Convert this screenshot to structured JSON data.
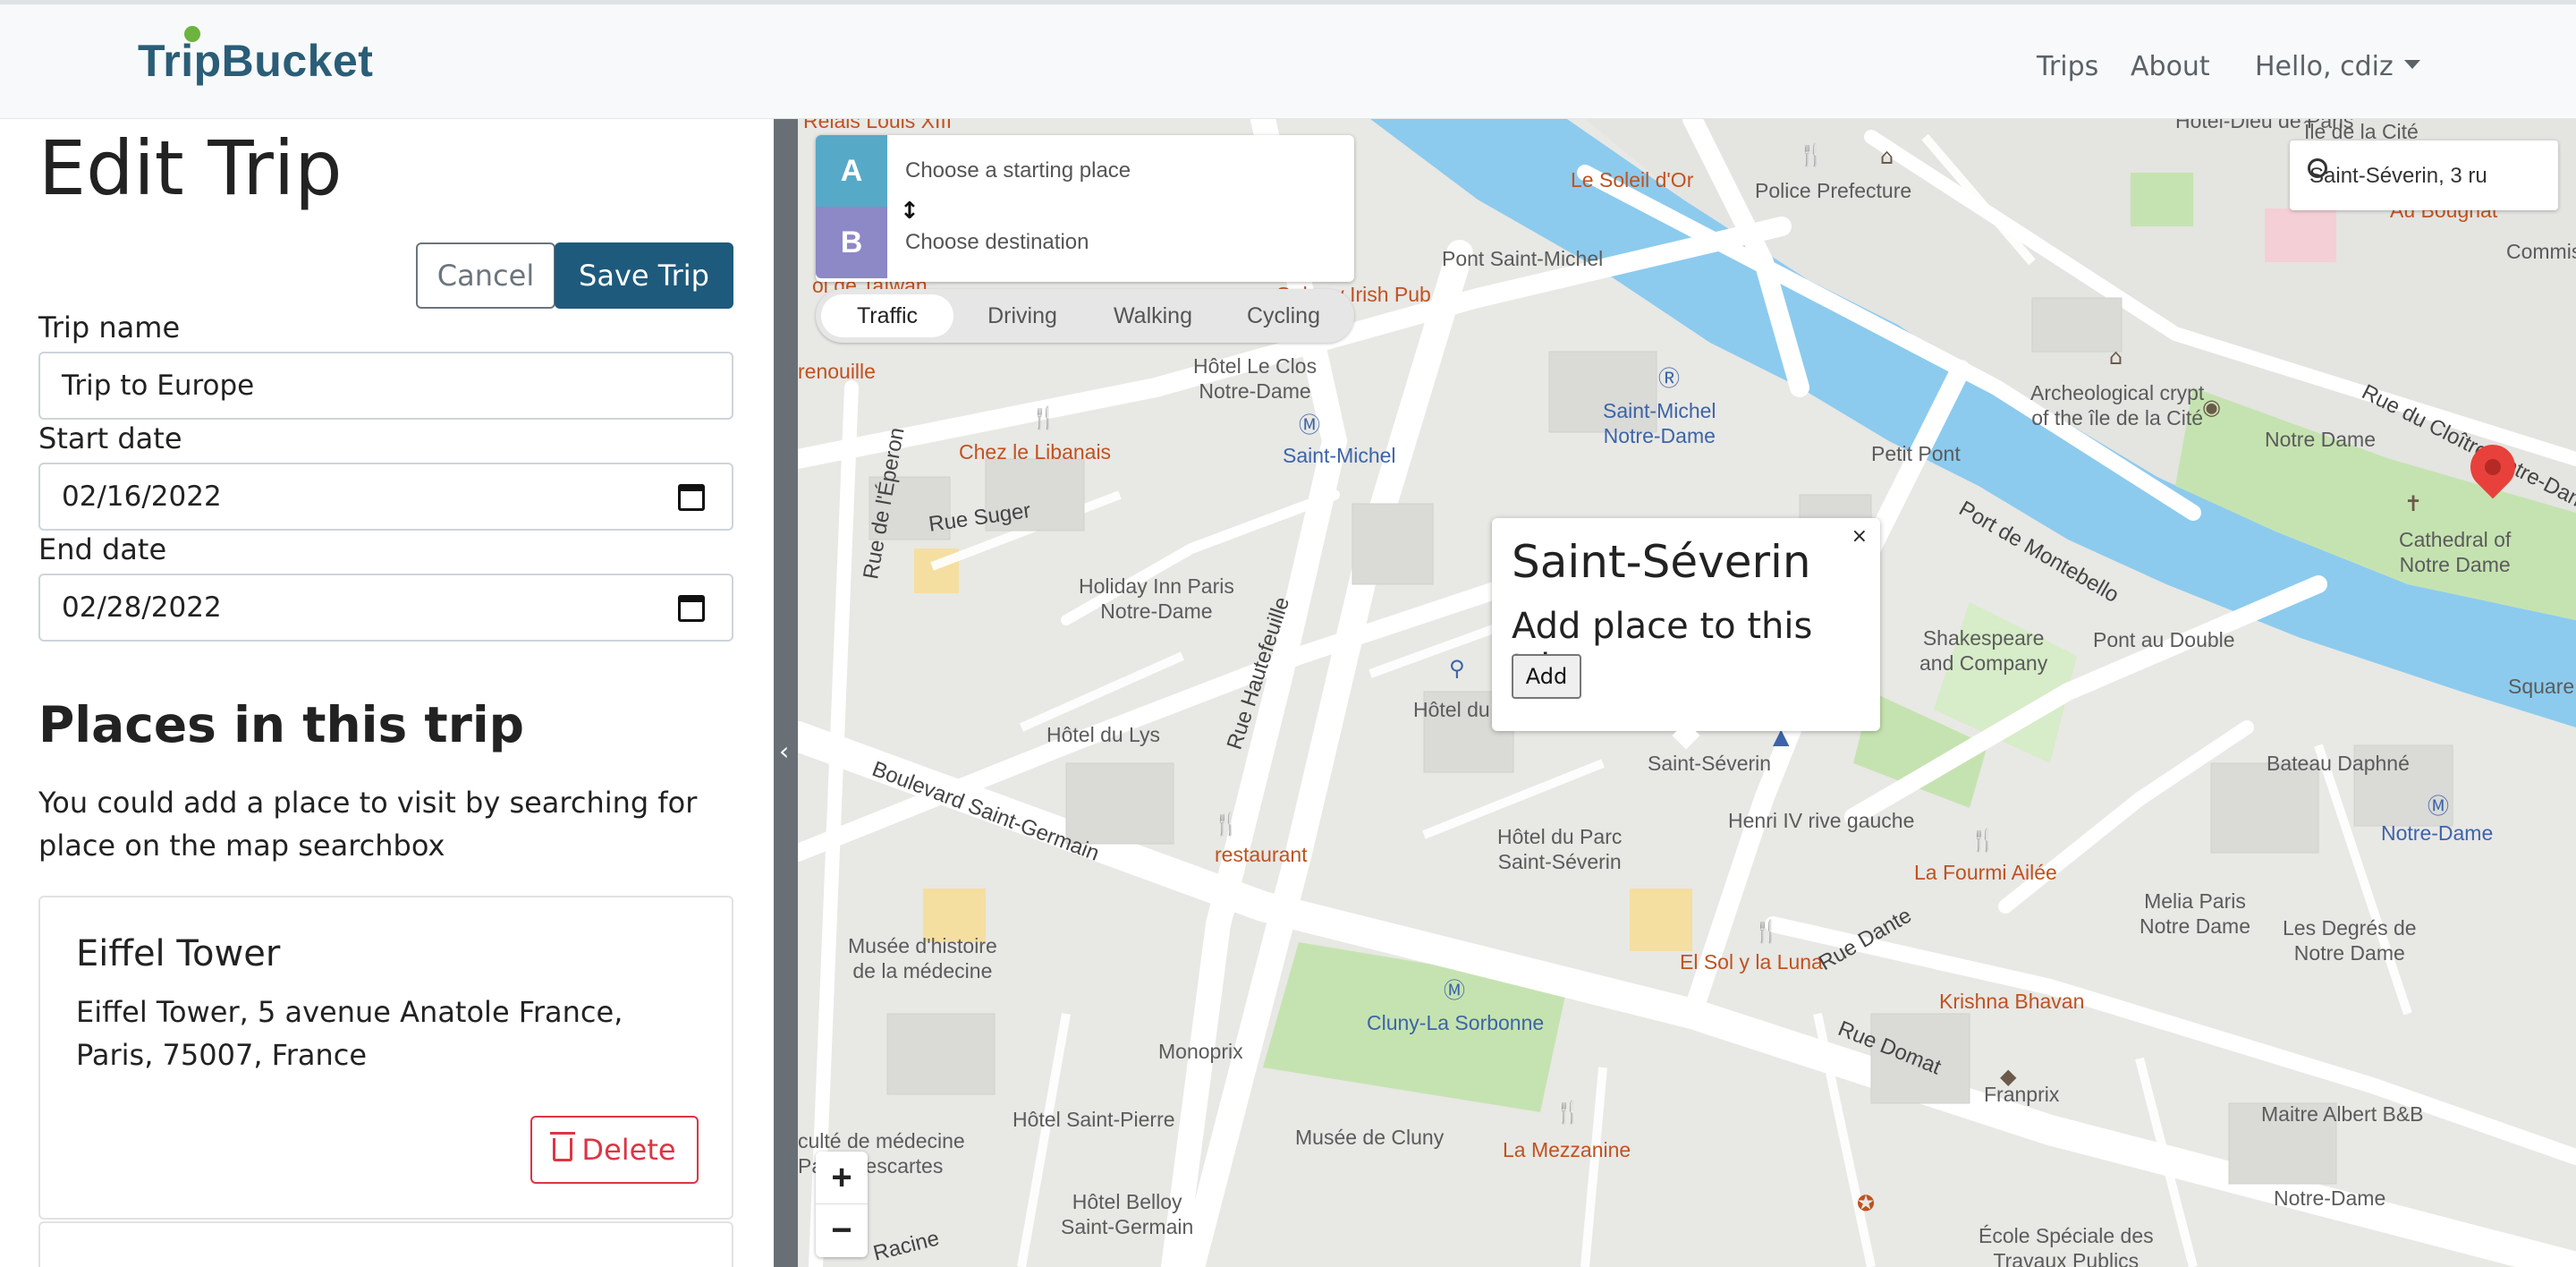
{
  "navbar": {
    "brand": "TripBucket",
    "links": {
      "trips": "Trips",
      "about": "About",
      "user": "Hello, cdiz"
    }
  },
  "form": {
    "title": "Edit Trip",
    "cancel_label": "Cancel",
    "save_label": "Save Trip",
    "trip_name_label": "Trip name",
    "trip_name_value": "Trip to Europe",
    "start_date_label": "Start date",
    "start_date_value": "02/16/2022",
    "end_date_label": "End date",
    "end_date_value": "02/28/2022"
  },
  "places": {
    "title": "Places in this trip",
    "description": "You could add a place to visit by searching for place on the map searchbox",
    "items": [
      {
        "name": "Eiffel Tower",
        "address": "Eiffel Tower, 5 avenue Anatole France, Paris, 75007, France",
        "delete_label": "Delete"
      }
    ]
  },
  "map": {
    "directions": {
      "a_label": "A",
      "b_label": "B",
      "start_placeholder": "Choose a starting place",
      "dest_placeholder": "Choose destination",
      "modes": [
        "Traffic",
        "Driving",
        "Walking",
        "Cycling"
      ],
      "active_mode": "Traffic"
    },
    "search_value": "Saint-Séverin, 3 ru",
    "popup": {
      "close": "×",
      "title": "Saint-Séverin",
      "subtitle": "Add place to this trip",
      "add_label": "Add"
    },
    "zoom": {
      "in": "+",
      "out": "−"
    },
    "labels": {
      "relais": "Relais Louis XIII",
      "ile_cite": "Île de la Cité",
      "hotel_dieu": "Hôtel-Dieu de Paris",
      "soleil": "Le Soleil d'Or",
      "police": "Police Prefecture",
      "au_bougnat": "Au Bougnat",
      "commis": "Commis",
      "pont_sm": "Pont Saint-Michel",
      "galway": "Galway Irish Pub",
      "taiwan": "ol de Taïwan",
      "hotel_closs": "Hôtel Le Clos\nNotre-Dame",
      "renouille": "renouille",
      "sm_nd": "Saint-Michel\nNotre-Dame",
      "archeo": "Archeological crypt\nof the île de la Cité",
      "notre_dame": "Notre Dame",
      "cloitre": "Rue du Cloître Notre-Dame",
      "chez": "Chez le Libanais",
      "saint_michel": "Saint-Michel",
      "petit_pont": "Petit Pont",
      "montebello": "Port de Montebello",
      "cathedral": "Cathedral of\nNotre Dame",
      "eperon": "Rue de l'Éperon",
      "suger": "Rue Suger",
      "holiday": "Holiday Inn Paris\nNotre-Dame",
      "hautefeuille": "Rue Hautefeuille",
      "shakespeare": "Shakespeare\nand Company",
      "pont_double": "Pont au Double",
      "square": "Square Jea",
      "hotel_lys": "Hôtel du Lys",
      "hotel_du": "Hôtel du",
      "bateau": "Bateau Daphné",
      "boul_sg": "Boulevard Saint-Germain",
      "saint_severin": "Saint-Séverin",
      "henri": "Henri IV rive gauche",
      "notre_dame_metro": "Notre-Dame",
      "restaurant": "restaurant",
      "hotel_parc": "Hôtel du Parc\nSaint-Séverin",
      "fourmi": "La Fourmi Ailée",
      "melia": "Melia Paris\nNotre Dame",
      "degres": "Les Degrés de\nNotre Dame",
      "musee_hist": "Musée d'histoire\nde la médecine",
      "sol_luna": "El Sol y la Luna",
      "rue_dante": "Rue Dante",
      "krishna": "Krishna Bhavan",
      "cluny": "Cluny-La Sorbonne",
      "monoprix": "Monoprix",
      "rue_domat": "Rue Domat",
      "franprix": "Franprix",
      "maitre": "Maitre Albert B&B",
      "faculte": "culté de médecine\nParis Descartes",
      "hotel_sp": "Hôtel Saint-Pierre",
      "musee_cluny": "Musée de Cluny",
      "mezzanine": "La Mezzanine",
      "notre_dame_b": "Notre-Dame",
      "belloy": "Hôtel Belloy\nSaint-Germain",
      "racine": "Racine",
      "ecole": "École Spéciale des\nTravaux Publics"
    }
  },
  "colors": {
    "brand": "#2a5d77",
    "save": "#1e5a7c",
    "danger": "#dc3545",
    "water": "#8ccbee",
    "park": "#c5e3b0"
  }
}
